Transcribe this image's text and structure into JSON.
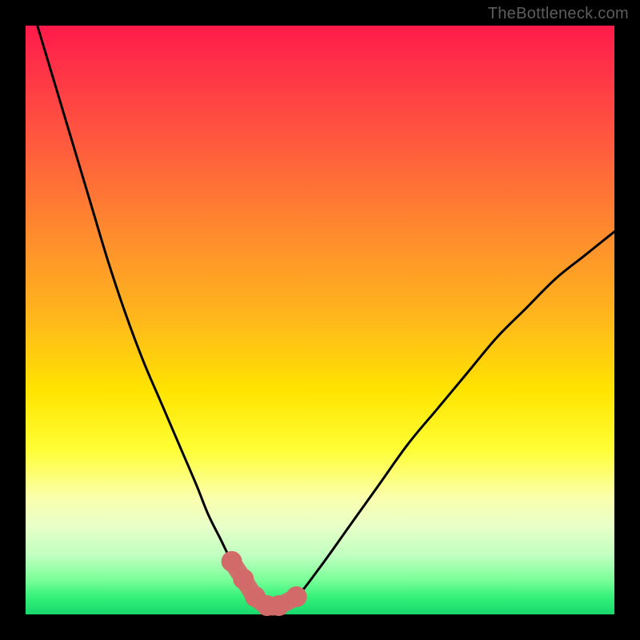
{
  "watermark": "TheBottleneck.com",
  "chart_data": {
    "type": "line",
    "title": "",
    "xlabel": "",
    "ylabel": "",
    "xlim": [
      0,
      100
    ],
    "ylim": [
      0,
      100
    ],
    "series": [
      {
        "name": "bottleneck-curve",
        "x": [
          2,
          5,
          8,
          11,
          14,
          17,
          20,
          23,
          26,
          29,
          31,
          33,
          35,
          37,
          39,
          41,
          43,
          46,
          50,
          55,
          60,
          65,
          70,
          75,
          80,
          85,
          90,
          95,
          100
        ],
        "values": [
          100,
          90,
          80,
          70,
          60,
          51,
          43,
          36,
          29,
          22,
          17,
          13,
          9,
          6,
          3,
          1.5,
          1.5,
          3,
          8,
          15,
          22,
          29,
          35,
          41,
          47,
          52,
          57,
          61,
          65
        ]
      }
    ],
    "highlight": {
      "name": "optimal-zone",
      "color": "#d36a6a",
      "x": [
        35,
        37,
        39,
        41,
        43,
        46
      ],
      "values": [
        9,
        6,
        3,
        1.5,
        1.5,
        3
      ]
    },
    "annotations": []
  }
}
